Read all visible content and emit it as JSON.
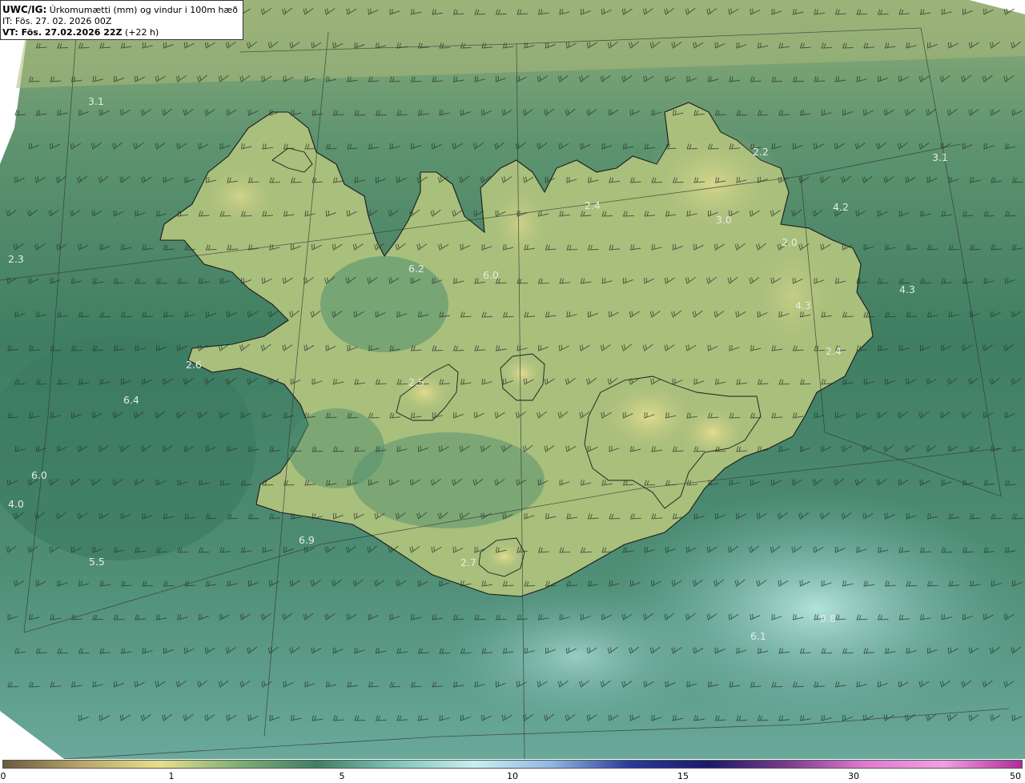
{
  "header": {
    "product": "UWC/IG:",
    "title_rest": " Úrkomumætti (mm) og vindur i 100m hæð",
    "init_time": "IT: Fös. 27. 02. 2026 00Z",
    "valid_time": "VT: Fös. 27.02.2026 22Z",
    "lead": " (+22 h)"
  },
  "colors": {
    "land_high": "#d8d88a",
    "land_mid": "#9fba7a",
    "sea_green": "#4a8a6a",
    "sea_dark": "#2e6e58",
    "sea_light": "#9fd6cc",
    "coast_line": "#1a1a1a",
    "barb": "#2a3a2a"
  },
  "map_labels": [
    {
      "text": "3.1"
    },
    {
      "text": "2.3"
    },
    {
      "text": "2.6"
    },
    {
      "text": "6.4"
    },
    {
      "text": "6.0"
    },
    {
      "text": "4.0"
    },
    {
      "text": "5.5"
    },
    {
      "text": "6.9"
    },
    {
      "text": "6.2"
    },
    {
      "text": "6.0"
    },
    {
      "text": "2.5"
    },
    {
      "text": "2.4"
    },
    {
      "text": "2.2"
    },
    {
      "text": "3.0"
    },
    {
      "text": "2.0"
    },
    {
      "text": "3.1"
    },
    {
      "text": "4.2"
    },
    {
      "text": "4.3"
    },
    {
      "text": "4.3"
    },
    {
      "text": "2.4"
    },
    {
      "text": "2.7"
    },
    {
      "text": "6.1"
    },
    {
      "text": "9.8"
    }
  ],
  "colorbar": {
    "ticks": [
      "0",
      "1",
      "5",
      "10",
      "15",
      "30",
      "50"
    ],
    "stops": [
      "#6b5a3f",
      "#b8a66a",
      "#e6e08a",
      "#7fae78",
      "#3f7f64",
      "#7fc4b8",
      "#c8f0f0",
      "#8fb8e0",
      "#2a3a9a",
      "#1a1a6a",
      "#7a3a8a",
      "#e07ad0",
      "#f0a0e0",
      "#b02a9a"
    ]
  }
}
